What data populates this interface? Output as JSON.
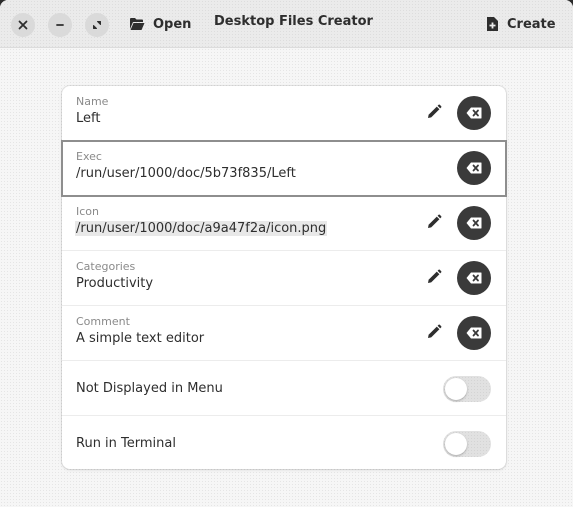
{
  "header": {
    "title": "Desktop Files Creator",
    "open_label": "Open",
    "create_label": "Create",
    "icons": {
      "close": "close-icon",
      "minimize": "minimize-icon",
      "maximize": "maximize-icon",
      "open": "folder-open-icon",
      "create": "document-new-icon"
    }
  },
  "fields": [
    {
      "label": "Name",
      "value": "Left",
      "editable": true
    },
    {
      "label": "Exec",
      "value": "/run/user/1000/doc/5b73f835/Left",
      "editable": false,
      "focused": true
    },
    {
      "label": "Icon",
      "value": "/run/user/1000/doc/a9a47f2a/icon.png",
      "editable": true
    },
    {
      "label": "Categories",
      "value": "Productivity",
      "editable": true
    },
    {
      "label": "Comment",
      "value": "A simple text editor",
      "editable": true
    }
  ],
  "switches": [
    {
      "label": "Not Displayed in Menu",
      "active": false
    },
    {
      "label": "Run in Terminal",
      "active": false
    }
  ],
  "colors": {
    "accent_dark": "#3a3a3a",
    "focus_border": "#8e8e8e"
  }
}
